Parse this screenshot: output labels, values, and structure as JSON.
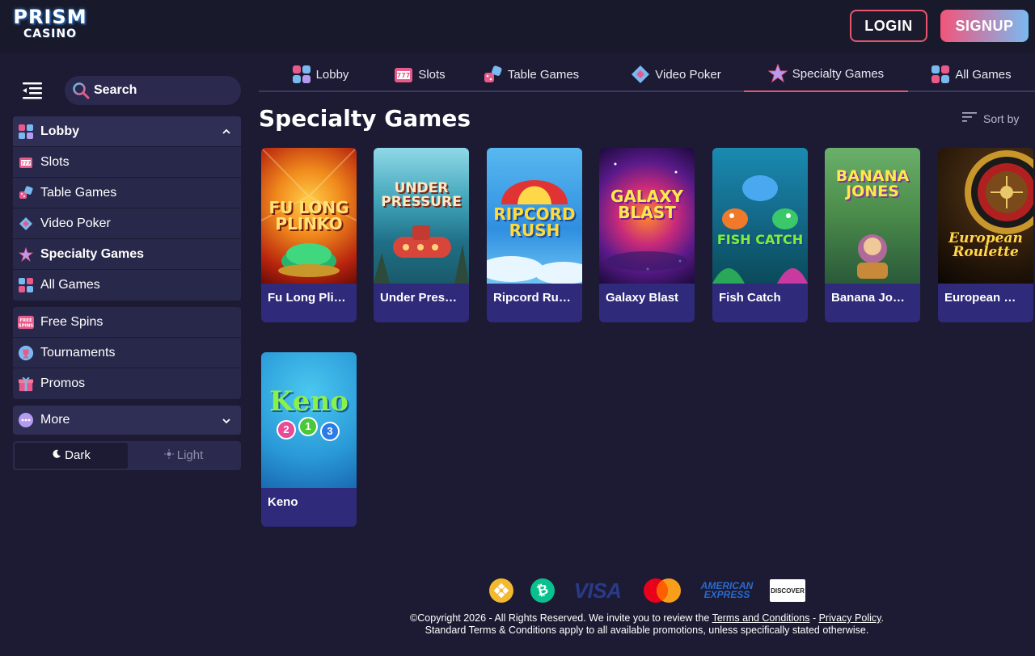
{
  "header": {
    "logo_line1": "PRISM",
    "logo_line2": "CASINO",
    "login_label": "LOGIN",
    "signup_label": "SIGNUP"
  },
  "sidebar": {
    "search_label": "Search",
    "games": [
      {
        "label": "Lobby",
        "icon": "lobby-icon"
      },
      {
        "label": "Slots",
        "icon": "slots-icon"
      },
      {
        "label": "Table Games",
        "icon": "table-games-icon"
      },
      {
        "label": "Video Poker",
        "icon": "video-poker-icon"
      },
      {
        "label": "Specialty Games",
        "icon": "specialty-games-icon"
      },
      {
        "label": "All Games",
        "icon": "all-games-icon"
      }
    ],
    "extras": [
      {
        "label": "Free Spins",
        "icon": "free-spins-icon",
        "icon_text": "FREE SPINS"
      },
      {
        "label": "Tournaments",
        "icon": "trophy-icon"
      },
      {
        "label": "Promos",
        "icon": "gift-icon"
      }
    ],
    "more_label": "More",
    "theme": {
      "dark_label": "Dark",
      "light_label": "Light",
      "selected": "Dark"
    }
  },
  "tabs": [
    {
      "label": "Lobby",
      "icon": "lobby-icon"
    },
    {
      "label": "Slots",
      "icon": "slots-icon"
    },
    {
      "label": "Table Games",
      "icon": "table-games-icon"
    },
    {
      "label": "Video Poker",
      "icon": "video-poker-icon"
    },
    {
      "label": "Specialty Games",
      "icon": "specialty-games-icon",
      "active": true
    },
    {
      "label": "All Games",
      "icon": "all-games-icon"
    }
  ],
  "main": {
    "title": "Specialty Games",
    "sort_label": "Sort by"
  },
  "games": [
    {
      "name": "Fu Long Plinko",
      "display": "Fu Long Pli…",
      "art": "FU LONG PLINKO"
    },
    {
      "name": "Under Pressure",
      "display": "Under Pres…",
      "art": "UNDER PRESSURE"
    },
    {
      "name": "Ripcord Rush",
      "display": "Ripcord Ru…",
      "art": "RIPCORD RUSH"
    },
    {
      "name": "Galaxy Blast",
      "display": "Galaxy Blast",
      "art": "GALAXY BLAST"
    },
    {
      "name": "Fish Catch",
      "display": "Fish Catch",
      "art": "FISH CATCH"
    },
    {
      "name": "Banana Jones",
      "display": "Banana Jo…",
      "art": "BANANA JONES"
    },
    {
      "name": "European Roulette",
      "display": "European …",
      "art": "European Roulette"
    },
    {
      "name": "Keno",
      "display": "Keno",
      "art": "Keno",
      "balls": [
        "2",
        "1",
        "3"
      ]
    }
  ],
  "footer": {
    "payments": [
      {
        "name": "binance-icon"
      },
      {
        "name": "bitcoin-cash-icon",
        "glyph": "₿"
      },
      {
        "name": "visa-logo",
        "text": "VISA"
      },
      {
        "name": "mastercard-logo"
      },
      {
        "name": "american-express-logo",
        "text1": "AMERICAN",
        "text2": "EXPRESS"
      },
      {
        "name": "discover-logo",
        "text": "DISCOVER"
      }
    ],
    "copyright_prefix": "©Copyright 2026 - All Rights Reserved. We invite you to review the ",
    "terms_link": "Terms and Conditions",
    "separator": " - ",
    "privacy_link": "Privacy Policy",
    "period": ".",
    "line2": "Standard Terms & Conditions apply to all available promotions, unless specifically stated otherwise."
  },
  "colors": {
    "background": "#1c1b33",
    "header_bg": "#181a2b",
    "accent_red": "#e8556e",
    "card_footer": "#2f2a7a",
    "sidebar_item": "#28284a"
  }
}
